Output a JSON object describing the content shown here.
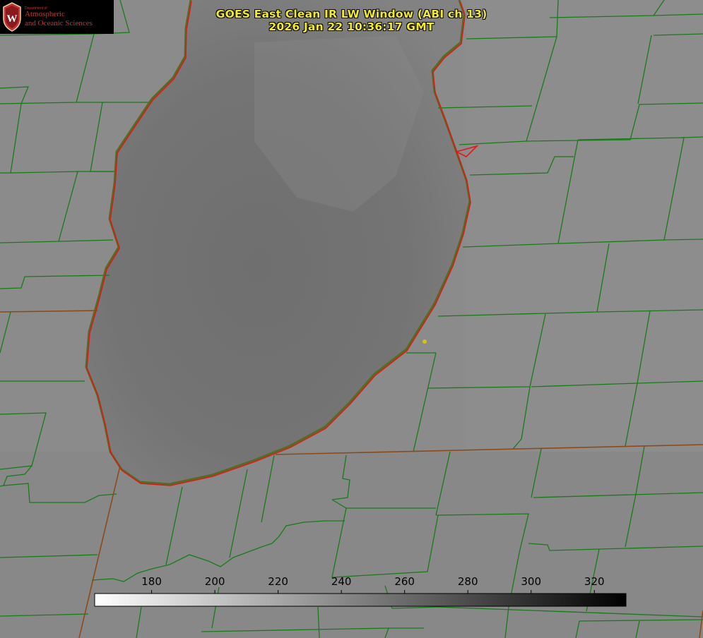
{
  "title": {
    "line1": "GOES East Clean IR LW Window (ABI ch 13)",
    "line2": "2026 Jan 22 10:36:17 GMT"
  },
  "logo": {
    "dept": "Department of",
    "line1": "Atmospheric",
    "line2": "and Oceanic Sciences",
    "seal_letter": "W"
  },
  "colorbar": {
    "ticks": [
      180,
      200,
      220,
      240,
      260,
      280,
      300,
      320
    ],
    "range": [
      162,
      330
    ],
    "low_color": "#ffffff",
    "high_color": "#000000"
  },
  "colors": {
    "title": "#f2ea2a",
    "county_lines": "#1a7a1a",
    "state_lines": "#b34a1a",
    "lake_outline": "#e11818",
    "marker": "#d4c21a",
    "logo_red": "#c0353a"
  },
  "layers": [
    "lake-michigan",
    "county-borders",
    "state-borders",
    "station-marker",
    "colorbar"
  ]
}
